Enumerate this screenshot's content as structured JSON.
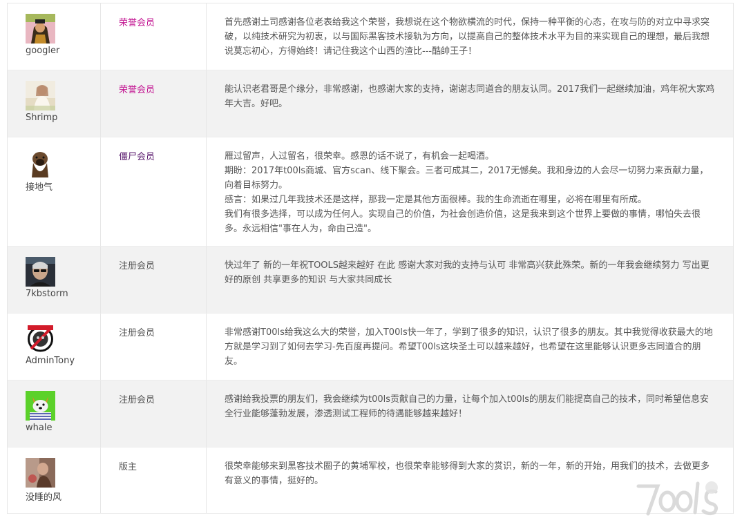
{
  "rows": [
    {
      "username": "googler",
      "group": "荣誉会员",
      "group_color": "#c21391",
      "avatar_icon": "avatar-portrait-icon",
      "message": [
        "首先感谢土司感谢各位老表给我这个荣誉，我想说在这个物欲横流的时代，保持一种平衡的心态，在攻与防的对立中寻求突破，以纯技术研究为初衷，以与国际黑客技术接轨为方向，以提高自己的整体技术水平为目的来实现自己的理想，最后我想说莫忘初心，方得始终！请记住我这个山西的渣比---酷帥王子！"
      ]
    },
    {
      "username": "Shrimp",
      "group": "荣誉会员",
      "group_color": "#c21391",
      "avatar_icon": "avatar-photo-icon",
      "message": [
        "能认识老君哥是个缘分，非常感谢，也感谢大家的支持，谢谢志同道合的朋友认同。2017我们一起继续加油，鸡年祝大家鸡年大吉。好吧。"
      ]
    },
    {
      "username": "接地气",
      "group": "僵尸会员",
      "group_color": "#5a1a6e",
      "avatar_icon": "avatar-dog-icon",
      "message": [
        "雁过留声，人过留名，很荣幸。感恩的话不说了，有机会一起喝酒。",
        "期盼：2017年t00ls商城、官方scan、线下聚会。三者可成其二，2017无憾矣。我和身边的人会尽一切努力来贡献力量，向着目标努力。",
        "感言：如果过几年我技术还是这样，那我一定是其他方面很棒。我的生命流逝在哪里，必将在哪里有所成。",
        "我们有很多选择，可以成为任何人。实现自己的价值，为社会创造价值，这是我来到这个世界上要做的事情，哪怕失去很多。永远相信\"事在人为，命由己造\"。"
      ]
    },
    {
      "username": "7kbstorm",
      "group": "注册会员",
      "group_color": "#555555",
      "avatar_icon": "avatar-man-icon",
      "message": [
        "快过年了 新的一年祝TOOLS越来越好 在此 感谢大家对我的支持与认可 非常高兴获此殊荣。新的一年我会继续努力 写出更好的原创 共享更多的知识 与大家共同成长"
      ]
    },
    {
      "username": "AdminTony",
      "group": "注册会员",
      "group_color": "#555555",
      "avatar_icon": "avatar-badge-icon",
      "message": [
        "非常感谢T00ls给我这么大的荣誉，加入T00ls快一年了，学到了很多的知识，认识了很多的朋友。其中我觉得收获最大的地方就是学习到了如何去学习-先百度再提问。希望T00ls这块圣土可以越来越好，也希望在这里能够认识更多志同道合的朋友。"
      ]
    },
    {
      "username": "whale",
      "group": "注册会员",
      "group_color": "#555555",
      "avatar_icon": "avatar-cartoon-dog-icon",
      "message": [
        "感谢给我投票的朋友们，我会继续为t00ls贡献自己的力量，让每个加入t00ls的朋友们能提高自己的技术，同时希望信息安全行业能够蓬勃发展，渗透测试工程师的待遇能够越来越好！"
      ]
    },
    {
      "username": "没睡的风",
      "group": "版主",
      "group_color": "#555555",
      "avatar_icon": "avatar-person-icon",
      "message": [
        "很荣幸能够来到黑客技术圈子的黄埔军校，也很荣幸能够得到大家的赏识，新的一年，新的开始，用我们的技术，去做更多有意义的事情，挺好的。"
      ]
    }
  ],
  "watermark_icon": "t00ls-watermark-icon"
}
